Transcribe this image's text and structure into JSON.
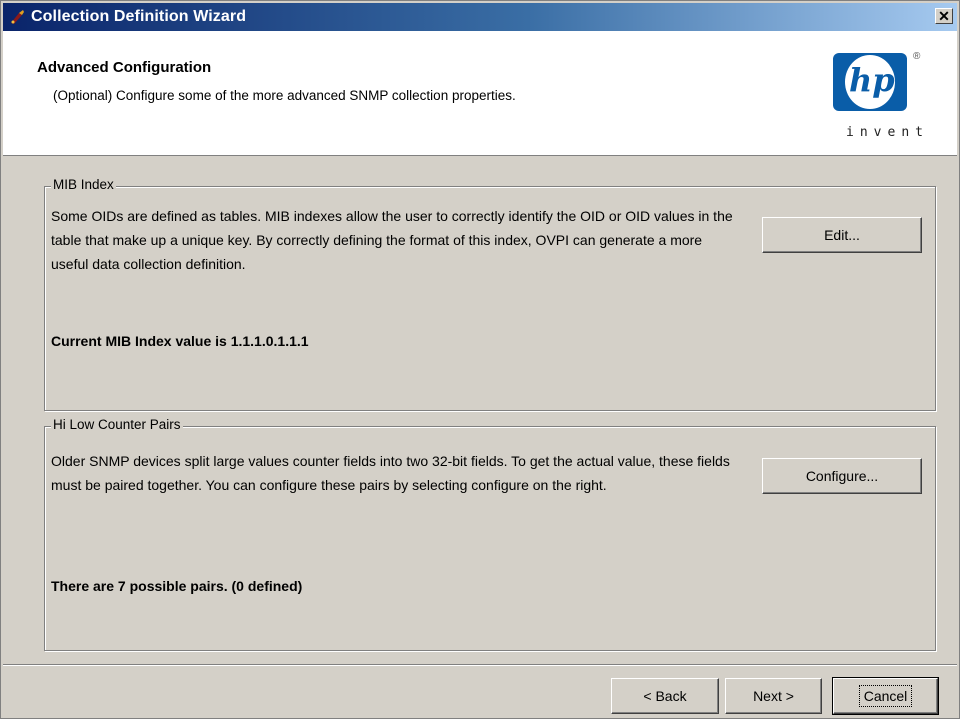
{
  "window": {
    "title": "Collection Definition Wizard",
    "close_glyph": "✕"
  },
  "header": {
    "title": "Advanced Configuration",
    "subtitle": "(Optional) Configure some of the more advanced SNMP collection properties.",
    "logo": {
      "mark": "hp",
      "registered": "®",
      "tagline": "invent"
    }
  },
  "mib_index": {
    "legend": "MIB Index",
    "description": "Some OIDs are defined as tables. MIB indexes allow the user to correctly identify the OID or OID values in the table that make up a unique key. By correctly defining the format of this index, OVPI can generate a more useful data collection definition.",
    "status": "Current MIB Index value is 1.1.1.0.1.1.1",
    "button_label": "Edit..."
  },
  "counter_pairs": {
    "legend": "Hi Low Counter Pairs",
    "description": "Older SNMP devices split large values counter fields into two 32-bit fields. To get the actual value, these fields must be paired together. You can configure these pairs by selecting configure on the right.",
    "status": "There are 7 possible pairs. (0 defined)",
    "button_label": "Configure..."
  },
  "footer": {
    "back_label": "< Back",
    "next_label": "Next >",
    "cancel_label": "Cancel"
  },
  "colors": {
    "titlebar_start": "#0a246a",
    "titlebar_end": "#a6caf0",
    "hp_blue": "#0a5da8",
    "dialog_face": "#d4d0c8"
  }
}
